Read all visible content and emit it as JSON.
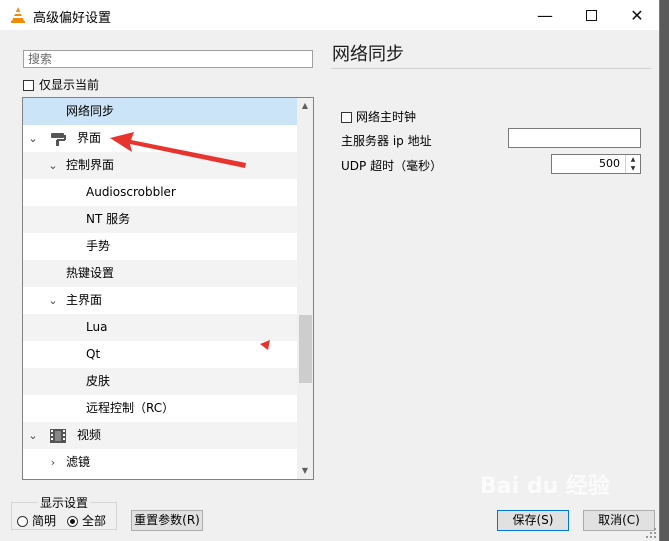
{
  "window": {
    "title": "高级偏好设置"
  },
  "search": {
    "placeholder": "搜索"
  },
  "only_current": {
    "label": "仅显示当前"
  },
  "tree": {
    "items": [
      {
        "label": "网络同步",
        "selected": true
      },
      {
        "label": "界面",
        "expanded": true
      },
      {
        "label": "控制界面",
        "expanded": true
      },
      {
        "label": "Audioscrobbler"
      },
      {
        "label": "NT 服务"
      },
      {
        "label": "手势"
      },
      {
        "label": "热键设置"
      },
      {
        "label": "主界面",
        "expanded": true
      },
      {
        "label": "Lua"
      },
      {
        "label": "Qt"
      },
      {
        "label": "皮肤"
      },
      {
        "label": "远程控制（RC）"
      },
      {
        "label": "视频",
        "expanded": true
      },
      {
        "label": "滤镜",
        "expanded": false
      }
    ]
  },
  "panel": {
    "title": "网络同步",
    "master_clock_label": "网络主时钟",
    "server_ip_label": "主服务器 ip 地址",
    "server_ip_value": "",
    "udp_timeout_label": "UDP 超时（毫秒）",
    "udp_timeout_value": "500"
  },
  "display_settings": {
    "title": "显示设置",
    "simple_label": "简明",
    "all_label": "全部",
    "selected": "all"
  },
  "buttons": {
    "reset": "重置参数(R)",
    "save": "保存(S)",
    "cancel": "取消(C)"
  },
  "colors": {
    "selection": "#cce4f7",
    "annotation_arrow": "#e8342e",
    "primary_button_border": "#0078d7"
  },
  "watermark": "Bai du 经验"
}
